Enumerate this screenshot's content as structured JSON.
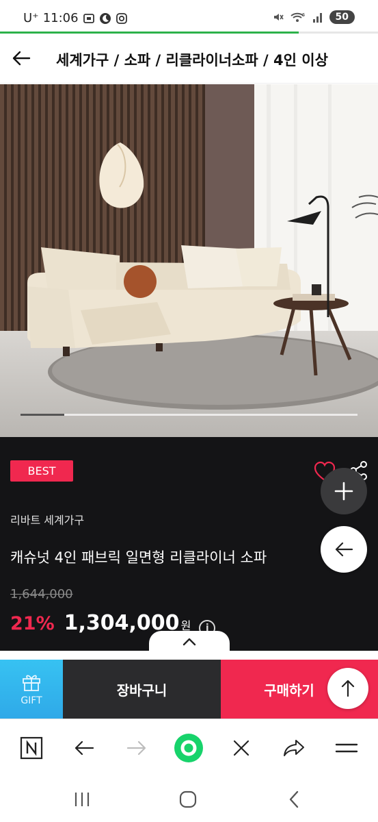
{
  "status_bar": {
    "carrier": "U⁺",
    "time": "11:06",
    "battery": "50",
    "wifi_label": "5"
  },
  "header": {
    "breadcrumb": "세계가구 / 소파 / 리클라이너소파 / 4인 이상"
  },
  "product": {
    "badge": "BEST",
    "brand": "리바트 세계가구",
    "title": "캐슈넛 4인 패브릭 일면형 리클라이너 소파",
    "original_price": "1,644,000",
    "discount": "21%",
    "price": "1,304,000",
    "currency": "원",
    "info_symbol": "i",
    "gallery_progress": 0.13
  },
  "purchase_bar": {
    "gift_label": "GIFT",
    "cart_label": "장바구니",
    "buy_label": "구매하기"
  },
  "colors": {
    "accent_red": "#f0284f",
    "dark_panel": "#141416",
    "gift_blue": "#37c2f2",
    "load_green": "#2db24a",
    "browser_green": "#17d36b"
  },
  "icons": {
    "back": "arrow-left-icon",
    "heart": "heart-outline-icon",
    "share": "share-icon",
    "plus": "plus-icon",
    "fab_back": "arrow-left-icon",
    "scroll_top": "arrow-up-icon",
    "expand": "chevron-up-icon",
    "gift": "gift-icon"
  }
}
